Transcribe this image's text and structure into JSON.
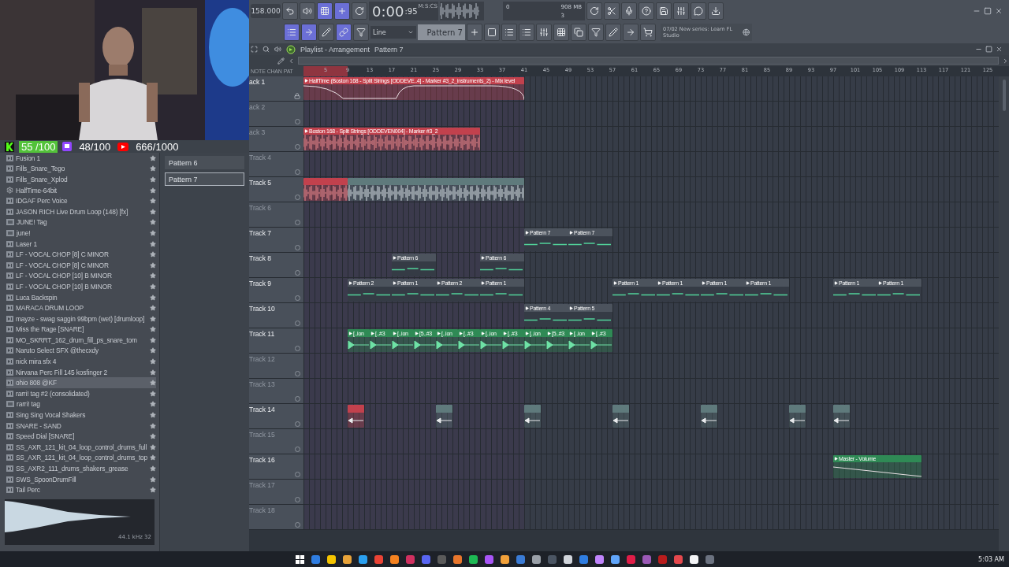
{
  "overlay": {
    "counters": [
      {
        "kind": "kick",
        "value": "55 /100"
      },
      {
        "kind": "twitch",
        "value": "48/100"
      },
      {
        "kind": "youtube",
        "value": "666/1000"
      }
    ]
  },
  "toolbar": {
    "tempo": "158.000",
    "time": "0:00",
    "time_fraction": ":95",
    "time_unit": "M:S:CS",
    "cpu": "0",
    "memory": "908 MB",
    "polyphony": "3",
    "snap": "Line",
    "pattern": "Pattern 7",
    "hint_date": "07/02",
    "hint": "New series: Learn FL Studio"
  },
  "browser": {
    "items": [
      {
        "label": "Fusion 1",
        "kind": "audio",
        "selected": false
      },
      {
        "label": "Fills_Snare_Tego",
        "kind": "audio",
        "selected": false
      },
      {
        "label": "Fills_Snare_Xplod",
        "kind": "audio",
        "selected": false
      },
      {
        "label": "HalfTime-64bit",
        "kind": "plugin",
        "selected": false
      },
      {
        "label": "IDGAF Perc Voice",
        "kind": "audio",
        "selected": false
      },
      {
        "label": "JASON RICH Live Drum Loop (148) [fx]",
        "kind": "audio",
        "selected": false
      },
      {
        "label": "JUNE! Tag",
        "kind": "mp3",
        "selected": false
      },
      {
        "label": "june!",
        "kind": "mp3",
        "selected": false
      },
      {
        "label": "Laser 1",
        "kind": "audio",
        "selected": false
      },
      {
        "label": "LF - VOCAL CHOP [8] C MINOR",
        "kind": "audio",
        "selected": false
      },
      {
        "label": "LF - VOCAL CHOP [8] C MINOR",
        "kind": "audio",
        "selected": false
      },
      {
        "label": "LF - VOCAL CHOP [10] B MINOR",
        "kind": "audio",
        "selected": false
      },
      {
        "label": "LF - VOCAL CHOP [10] B MINOR",
        "kind": "audio",
        "selected": false
      },
      {
        "label": "Luca Backspin",
        "kind": "audio",
        "selected": false
      },
      {
        "label": "MARACA DRUM LOOP",
        "kind": "audio",
        "selected": false
      },
      {
        "label": "mayze - swag saggin 99bpm (wet) [drumloop]",
        "kind": "audio",
        "selected": false
      },
      {
        "label": "Miss the Rage [SNARE]",
        "kind": "audio",
        "selected": false
      },
      {
        "label": "MO_SKRRT_162_drum_fill_ps_snare_tom",
        "kind": "audio",
        "selected": false
      },
      {
        "label": "Naruto Select SFX @thecxdy",
        "kind": "audio",
        "selected": false
      },
      {
        "label": "nick mira sfx 4",
        "kind": "audio",
        "selected": false
      },
      {
        "label": "Nirvana Perc Fill 145 kosfinger 2",
        "kind": "audio",
        "selected": false
      },
      {
        "label": "ohio 808 @KF",
        "kind": "audio",
        "selected": true
      },
      {
        "label": "rarri! tag #2 (consolidated)",
        "kind": "audio",
        "selected": false
      },
      {
        "label": "rarri! tag",
        "kind": "mp3",
        "selected": false
      },
      {
        "label": "Sing Sing Vocal Shakers",
        "kind": "audio",
        "selected": false
      },
      {
        "label": "SNARE - SAND",
        "kind": "audio",
        "selected": false
      },
      {
        "label": "Speed Dial [SNARE]",
        "kind": "audio",
        "selected": false
      },
      {
        "label": "SS_AXR_121_kit_04_loop_control_drums_full",
        "kind": "audio",
        "selected": false
      },
      {
        "label": "SS_AXR_121_kit_04_loop_control_drums_top",
        "kind": "audio",
        "selected": false
      },
      {
        "label": "SS_AXR2_111_drums_shakers_grease",
        "kind": "audio",
        "selected": false
      },
      {
        "label": "SWS_SpoonDrumFill",
        "kind": "audio",
        "selected": false
      },
      {
        "label": "Tail Perc",
        "kind": "audio",
        "selected": false
      }
    ],
    "preview_info": "44.1 kHz 32"
  },
  "picker": {
    "items": [
      {
        "label": "Pattern 6",
        "selected": false
      },
      {
        "label": "Pattern 7",
        "selected": true
      }
    ]
  },
  "playlist": {
    "title": "Playlist - Arrangement",
    "pattern": "Pattern 7",
    "ruler_modes": [
      "NOTE",
      "CHAN",
      "PAT"
    ],
    "ruler": [
      "5",
      "9",
      "13",
      "17",
      "21",
      "25",
      "29",
      "33",
      "37",
      "41",
      "45",
      "49",
      "53",
      "57",
      "61",
      "65",
      "69",
      "73",
      "77",
      "81",
      "85",
      "89",
      "93",
      "97",
      "101",
      "105",
      "109",
      "113",
      "117",
      "121",
      "125"
    ],
    "tracks": [
      {
        "name": "ack 1",
        "empty": false,
        "clips": [
          {
            "kind": "automation",
            "label": "HalfTime (Boston 168 - Split Strings [ODDEVE..4] - Marker #3_2_instruments_2) - Mix level",
            "color": "#c2414d"
          }
        ]
      },
      {
        "name": "ack 2",
        "empty": true
      },
      {
        "name": "ack 3",
        "empty": true,
        "clips": [
          {
            "kind": "audio",
            "label": "Boston 168 - Split Strings [ODDEVEN004] - Marker #3_2",
            "color": "#c2414d"
          }
        ]
      },
      {
        "name": "Track 4",
        "empty": true
      },
      {
        "name": "Track 5",
        "empty": false,
        "clips": [
          {
            "kind": "audio",
            "color": "#c2414d"
          },
          {
            "kind": "audio",
            "color": "#5f7a7c"
          }
        ]
      },
      {
        "name": "Track 6",
        "empty": true
      },
      {
        "name": "Track 7",
        "empty": false,
        "clips": [
          {
            "kind": "pattern",
            "label": "Pattern 7",
            "color": "#4c535d"
          },
          {
            "kind": "pattern",
            "label": "Pattern 7",
            "color": "#4c535d"
          }
        ]
      },
      {
        "name": "Track 8",
        "empty": false,
        "clips": [
          {
            "kind": "pattern",
            "label": "Pattern 6",
            "color": "#4c535d"
          },
          {
            "kind": "pattern",
            "label": "Pattern 6",
            "color": "#4c535d"
          }
        ]
      },
      {
        "name": "Track 9",
        "empty": false,
        "clips": [
          {
            "kind": "pattern",
            "label": "Pattern 2",
            "color": "#4c535d"
          },
          {
            "kind": "pattern",
            "label": "Pattern 1",
            "color": "#4c535d"
          },
          {
            "kind": "pattern",
            "label": "Pattern 2",
            "color": "#4c535d"
          },
          {
            "kind": "pattern",
            "label": "Pattern 1",
            "color": "#4c535d"
          },
          {
            "kind": "pattern",
            "label": "Pattern 1",
            "color": "#4c535d"
          },
          {
            "kind": "pattern",
            "label": "Pattern 1",
            "color": "#4c535d"
          },
          {
            "kind": "pattern",
            "label": "Pattern 1",
            "color": "#4c535d"
          },
          {
            "kind": "pattern",
            "label": "Pattern 1",
            "color": "#4c535d"
          },
          {
            "kind": "pattern",
            "label": "Pattern 1",
            "color": "#4c535d"
          },
          {
            "kind": "pattern",
            "label": "Pattern 1",
            "color": "#4c535d"
          }
        ]
      },
      {
        "name": "Track 10",
        "empty": false,
        "clips": [
          {
            "kind": "pattern",
            "label": "Pattern 4",
            "color": "#4c535d"
          },
          {
            "kind": "pattern",
            "label": "Pattern 5",
            "color": "#4c535d"
          }
        ]
      },
      {
        "name": "Track 11",
        "empty": false,
        "clips": [
          {
            "kind": "audio",
            "label": "[..ion",
            "color": "#2f8a55"
          },
          {
            "kind": "audio",
            "label": "[..#3",
            "color": "#2f8a55"
          },
          {
            "kind": "audio",
            "label": "[..ion",
            "color": "#2f8a55"
          },
          {
            "kind": "audio",
            "label": "[5..#3",
            "color": "#2f8a55"
          },
          {
            "kind": "audio",
            "label": "[..ion",
            "color": "#2f8a55"
          },
          {
            "kind": "audio",
            "label": "[..#3",
            "color": "#2f8a55"
          },
          {
            "kind": "audio",
            "label": "[..ion",
            "color": "#2f8a55"
          },
          {
            "kind": "audio",
            "label": "[..#3",
            "color": "#2f8a55"
          },
          {
            "kind": "audio",
            "label": "[..ion",
            "color": "#2f8a55"
          },
          {
            "kind": "audio",
            "label": "[5..#3",
            "color": "#2f8a55"
          },
          {
            "kind": "audio",
            "label": "[..ion",
            "color": "#2f8a55"
          },
          {
            "kind": "audio",
            "label": "[..#3",
            "color": "#2f8a55"
          }
        ]
      },
      {
        "name": "Track 12",
        "empty": true
      },
      {
        "name": "Track 13",
        "empty": true
      },
      {
        "name": "Track 14",
        "empty": false,
        "clips": [
          {
            "kind": "audio",
            "color": "#c2414d"
          },
          {
            "kind": "audio",
            "color": "#5f7a7c"
          },
          {
            "kind": "audio",
            "color": "#5f7a7c"
          },
          {
            "kind": "audio",
            "color": "#5f7a7c"
          },
          {
            "kind": "audio",
            "color": "#5f7a7c"
          },
          {
            "kind": "audio",
            "color": "#5f7a7c"
          },
          {
            "kind": "audio",
            "color": "#5f7a7c"
          }
        ]
      },
      {
        "name": "Track 15",
        "empty": true
      },
      {
        "name": "Track 16",
        "empty": false,
        "clips": [
          {
            "kind": "automation",
            "label": "Master - Volume",
            "color": "#2f8a55"
          }
        ]
      },
      {
        "name": "Track 17",
        "empty": true
      },
      {
        "name": "Track 18",
        "empty": true
      }
    ]
  },
  "taskbar": {
    "clock": "5:03 AM"
  }
}
